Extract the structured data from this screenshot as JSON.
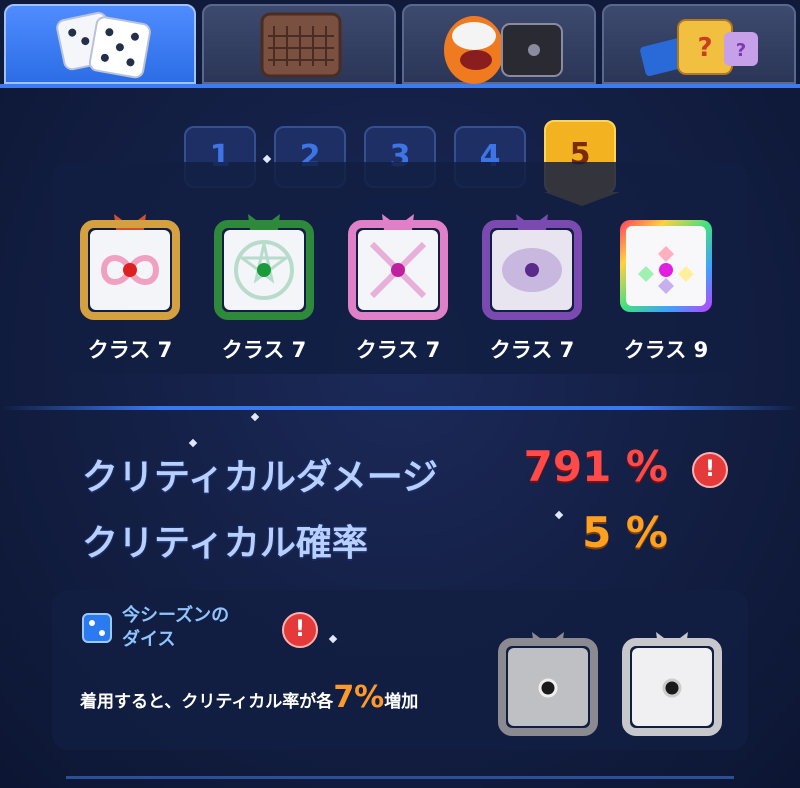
{
  "tabs": [
    {
      "icon": "dice-icon",
      "active": true
    },
    {
      "icon": "board-icon",
      "active": false
    },
    {
      "icon": "mascot-icon",
      "active": false
    },
    {
      "icon": "mystery-box-icon",
      "active": false
    }
  ],
  "deck_slots": [
    "1",
    "2",
    "3",
    "4",
    "5"
  ],
  "active_slot": "5",
  "deck": [
    {
      "class_label": "クラス 7",
      "pip_color": "#e02020",
      "frame_color": "#d4a040",
      "icon": "infinity-dice-icon"
    },
    {
      "class_label": "クラス 7",
      "pip_color": "#1a9a3a",
      "frame_color": "#2e8a3a",
      "icon": "star-dice-icon"
    },
    {
      "class_label": "クラス 7",
      "pip_color": "#c020a0",
      "frame_color": "#e080c8",
      "icon": "sword-dice-icon"
    },
    {
      "class_label": "クラス 7",
      "pip_color": "#5a2a8a",
      "frame_color": "#7a4ab0",
      "icon": "eye-dice-icon"
    },
    {
      "class_label": "クラス 9",
      "pip_color": "#e020e0",
      "frame_color": "#ffffff",
      "icon": "rainbow-dice-icon"
    }
  ],
  "stats": {
    "crit_damage_label": "クリティカルダメージ",
    "crit_damage_value": "791 %",
    "crit_rate_label": "クリティカル確率",
    "crit_rate_value": "5 %"
  },
  "season": {
    "title": "今シーズンの\nダイス",
    "desc_prefix": "着用すると、クリティカル率が各",
    "desc_pct": "7%",
    "desc_suffix": "増加",
    "alert_symbol": "!"
  },
  "colors": {
    "accent": "#3a78f0",
    "crit_damage": "#ff4a4a",
    "crit_rate": "#ffa020",
    "gold": "#f3b21f"
  }
}
